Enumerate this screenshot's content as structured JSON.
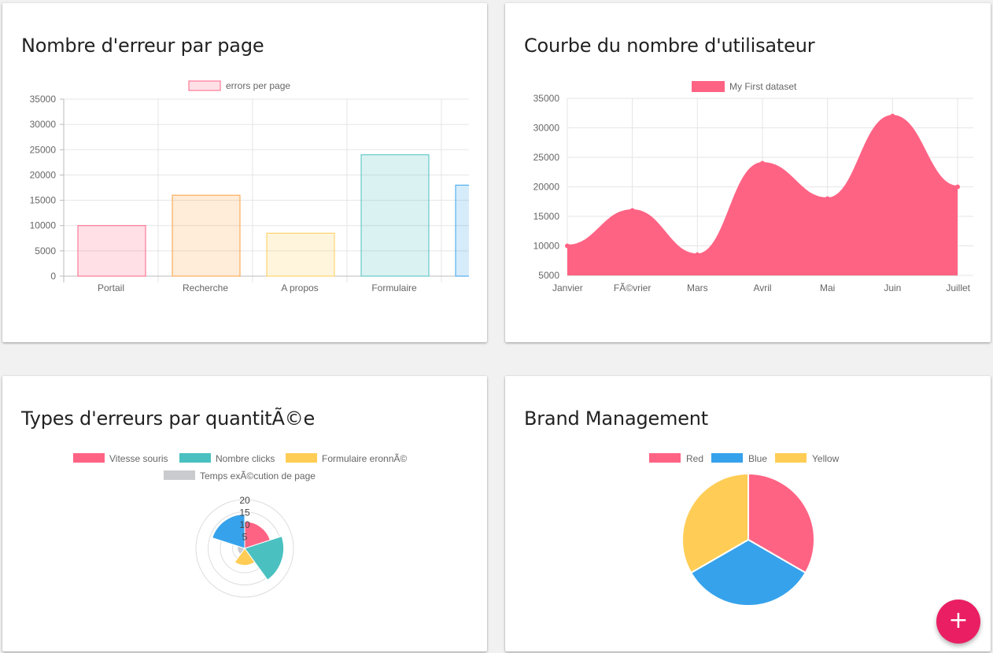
{
  "cards": {
    "errors_per_page": {
      "title": "Nombre d'erreur par page"
    },
    "user_curve": {
      "title": "Courbe du nombre d'utilisateur"
    },
    "error_types": {
      "title": "Types d'erreurs par quantitÃ©e"
    },
    "brand": {
      "title": "Brand Management"
    }
  },
  "fab": {
    "label": "+",
    "icon": "plus-icon",
    "color": "#e91e63"
  },
  "chart_data": [
    {
      "type": "bar",
      "title": "Nombre d'erreur par page",
      "categories": [
        "Portail",
        "Recherche",
        "A propos",
        "Formulaire",
        ""
      ],
      "series": [
        {
          "name": "errors per page",
          "values": [
            10000,
            16000,
            8500,
            24000,
            18000
          ]
        }
      ],
      "bar_colors": [
        "#ff6384",
        "#ff9f40",
        "#ffcd56",
        "#4bc0c0",
        "#36a2eb"
      ],
      "ylim": [
        0,
        35000
      ],
      "yticks": [
        "35000",
        "30000",
        "25000",
        "20000",
        "15000",
        "10000",
        "5000",
        "0"
      ],
      "grid": true,
      "legend": "top"
    },
    {
      "type": "area",
      "title": "Courbe du nombre d'utilisateur",
      "categories": [
        "Janvier",
        "FÃ©vrier",
        "Mars",
        "Avril",
        "Mai",
        "Juin",
        "Juillet"
      ],
      "series": [
        {
          "name": "My First dataset",
          "values": [
            10000,
            16000,
            8500,
            24000,
            18000,
            32000,
            20000
          ],
          "color": "#ff6384"
        }
      ],
      "ylim": [
        5000,
        35000
      ],
      "yticks": [
        "35000",
        "30000",
        "25000",
        "20000",
        "15000",
        "10000",
        "5000"
      ],
      "grid": true,
      "legend": "top"
    },
    {
      "type": "polarArea",
      "title": "Types d'erreurs par quantitÃ©e",
      "categories": [
        "Vitesse souris",
        "Nombre clicks",
        "Formulaire eronnÃ©",
        "Temps exÃ©cution de page",
        ""
      ],
      "values": [
        11,
        16,
        7,
        3,
        14
      ],
      "colors": [
        "#ff6384",
        "#4bc0c0",
        "#ffcd56",
        "#c9cbcf",
        "#36a2eb"
      ],
      "rlim": [
        0,
        20
      ],
      "rticks": [
        "20",
        "15",
        "10",
        "5"
      ],
      "legend": "top"
    },
    {
      "type": "pie",
      "title": "Brand Management",
      "categories": [
        "Red",
        "Blue",
        "Yellow"
      ],
      "values": [
        300,
        300,
        300
      ],
      "colors": [
        "#ff6384",
        "#36a2eb",
        "#ffcd56"
      ],
      "legend": "top"
    }
  ]
}
